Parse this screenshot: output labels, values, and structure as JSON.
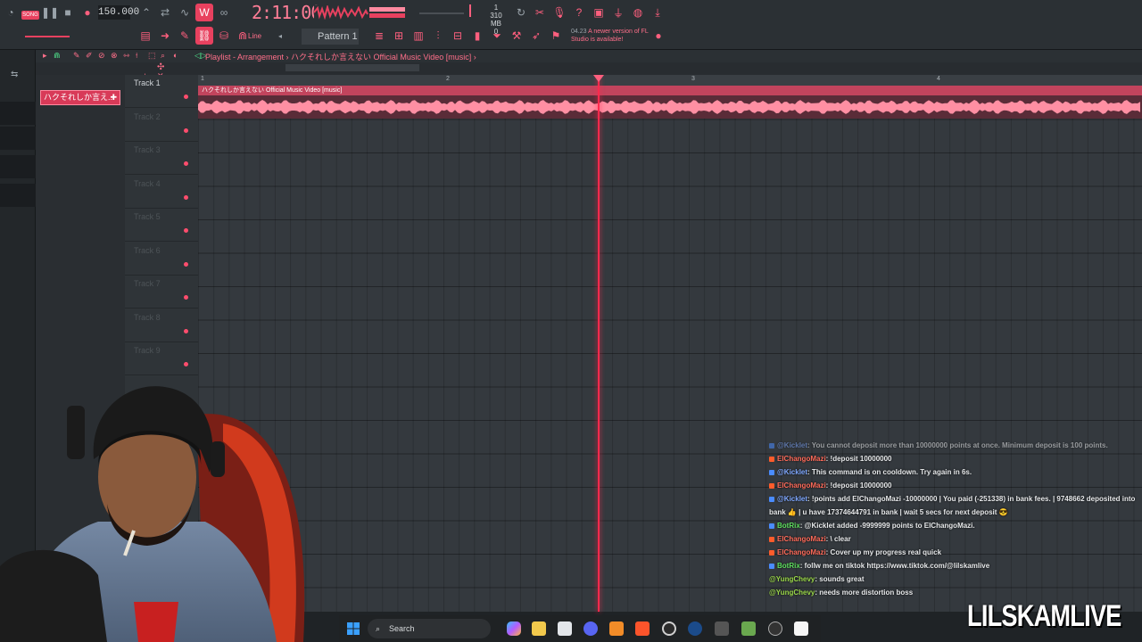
{
  "toolbar": {
    "song_mode": "SONG",
    "tempo": "150.000",
    "time": "2:11:00",
    "cpu_line1": "1",
    "cpu_line2": "310 MB",
    "cpu_line3": "0",
    "pattern": "Pattern 1",
    "snap": "Line",
    "update_version": "04.23",
    "update_text": "A newer version of FL Studio is available!"
  },
  "playlist": {
    "title": "Playlist - Arrangement",
    "breadcrumb": "ハクそれしか言えない Official Music Video [music]",
    "clip_chip": "ハクそれしか言え..",
    "audio_clip_label": "ハクそれしか言えない Official Music Video [music]",
    "ruler": [
      "1",
      "2",
      "3",
      "4"
    ],
    "tracks": [
      {
        "name": "Track 1",
        "dim": false
      },
      {
        "name": "Track 2",
        "dim": true
      },
      {
        "name": "Track 3",
        "dim": true
      },
      {
        "name": "Track 4",
        "dim": true
      },
      {
        "name": "Track 5",
        "dim": true
      },
      {
        "name": "Track 6",
        "dim": true
      },
      {
        "name": "Track 7",
        "dim": true
      },
      {
        "name": "Track 8",
        "dim": true
      },
      {
        "name": "Track 9",
        "dim": true
      }
    ]
  },
  "chat": [
    {
      "user": "@Kicklet",
      "user_color": "#7fa8ff",
      "text": ": You cannot deposit more than 10000000 points at once. Minimum deposit is 100 points.",
      "badge": "#4a8cff"
    },
    {
      "user": "ElChangoMazi",
      "user_color": "#ff6b5a",
      "text": ": !deposit 10000000",
      "badge": "#ff5c2b"
    },
    {
      "user": "@Kicklet",
      "user_color": "#7fa8ff",
      "text": ": This command is on cooldown. Try again in 6s.",
      "badge": "#4a8cff"
    },
    {
      "user": "ElChangoMazi",
      "user_color": "#ff6b5a",
      "text": ": !deposit 10000000",
      "badge": "#ff5c2b"
    },
    {
      "user": "@Kicklet",
      "user_color": "#7fa8ff",
      "text": ": !points add ElChangoMazi -10000000 | You paid (-251338) in bank fees. | 9748662 deposited into",
      "badge": "#4a8cff"
    },
    {
      "user": "",
      "user_color": "#ffffff",
      "text": "bank 👍 | u have 17374644791 in bank | wait 5 secs for next deposit 😎",
      "badge": ""
    },
    {
      "user": "BotRix",
      "user_color": "#5fe05f",
      "text": ": @Kicklet added -9999999 points to ElChangoMazi.",
      "badge": "#4a8cff"
    },
    {
      "user": "ElChangoMazi",
      "user_color": "#ff6b5a",
      "text": ": \\ clear",
      "badge": "#ff5c2b"
    },
    {
      "user": "ElChangoMazi",
      "user_color": "#ff6b5a",
      "text": ": Cover up my progress real quick",
      "badge": "#ff5c2b"
    },
    {
      "user": "BotRix",
      "user_color": "#5fe05f",
      "text": ": follw me on tiktok https://www.tiktok.com/@lilskamlive",
      "badge": "#4a8cff"
    },
    {
      "user": "@YungChevy",
      "user_color": "#9bd84a",
      "text": ": sounds great",
      "badge": ""
    },
    {
      "user": "@YungChevy",
      "user_color": "#9bd84a",
      "text": ": needs more distortion boss",
      "badge": ""
    }
  ],
  "taskbar": {
    "search_placeholder": "Search",
    "icons": [
      "windows-start-icon",
      "copilot-icon",
      "file-explorer-icon",
      "store-icon",
      "discord-icon",
      "fl-studio-icon",
      "brave-icon",
      "obs-icon",
      "steam-icon",
      "app-icon",
      "minecraft-icon",
      "ak-icon",
      "capcut-icon"
    ]
  },
  "watermark": "LILSKAMLIVE",
  "colors": {
    "accent": "#e8415f",
    "playhead": "#ff2a4d",
    "background": "#1f2326"
  }
}
